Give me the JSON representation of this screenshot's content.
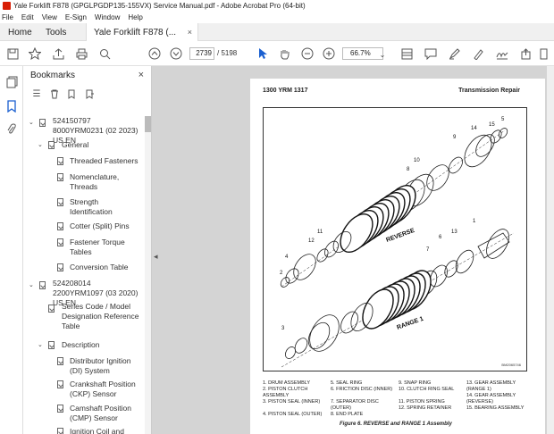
{
  "window": {
    "title": "Yale Forklift F878 (GPGLPGDP135-155VX) Service Manual.pdf - Adobe Acrobat Pro (64-bit)"
  },
  "menu": [
    "File",
    "Edit",
    "View",
    "E-Sign",
    "Window",
    "Help"
  ],
  "tabs": {
    "home": "Home",
    "tools": "Tools",
    "document": "Yale Forklift F878 (...",
    "close": "×"
  },
  "toolbar": {
    "page_current": "2739",
    "page_total": "/ 5198",
    "zoom": "66.7%"
  },
  "bookmarks": {
    "title": "Bookmarks",
    "close": "×",
    "items": [
      {
        "label": "524150797 8000YRM0231 (02 2023) US EN"
      },
      {
        "label": "General"
      },
      {
        "label": "Threaded Fasteners"
      },
      {
        "label": "Nomenclature, Threads"
      },
      {
        "label": "Strength Identification"
      },
      {
        "label": "Cotter (Split) Pins"
      },
      {
        "label": "Fastener Torque Tables"
      },
      {
        "label": "Conversion Table"
      },
      {
        "label": "524208014 2200YRM1097 (03 2020) US EN"
      },
      {
        "label": "Series Code / Model Designation Reference Table"
      },
      {
        "label": "Description"
      },
      {
        "label": "Distributor Ignition (DI) System"
      },
      {
        "label": "Crankshaft Position (CKP) Sensor"
      },
      {
        "label": "Camshaft Position (CMP) Sensor"
      },
      {
        "label": "Ignition Coil and"
      }
    ]
  },
  "page": {
    "header_left": "1300 YRM 1317",
    "header_right": "Transmission Repair",
    "figure_label_reverse": "REVERSE",
    "figure_label_range": "RANGE 1",
    "figure_id": "BM2065746",
    "caption": "Figure 6. REVERSE and RANGE 1 Assembly",
    "legend": [
      "1.   DRUM ASSEMBLY",
      "2.   PISTON CLUTCH ASSEMBLY",
      "3.   PISTON SEAL (INNER)",
      "4.   PISTON SEAL (OUTER)",
      "5.   SEAL RING",
      "6.   FRICTION DISC (INNER)",
      "7.   SEPARATOR DISC (OUTER)",
      "8.   END PLATE",
      "9.   SNAP RING",
      "10.  CLUTCH RING SEAL",
      "11.  PISTON SPRING",
      "12.  SPRING RETAINER",
      "13.  GEAR ASSEMBLY (RANGE 1)",
      "14.  GEAR ASSEMBLY (REVERSE)",
      "15.  BEARING ASSEMBLY"
    ],
    "callouts": [
      "1",
      "2",
      "3",
      "4",
      "5",
      "6",
      "7",
      "8",
      "9",
      "10",
      "11",
      "12",
      "13",
      "14",
      "15"
    ]
  }
}
